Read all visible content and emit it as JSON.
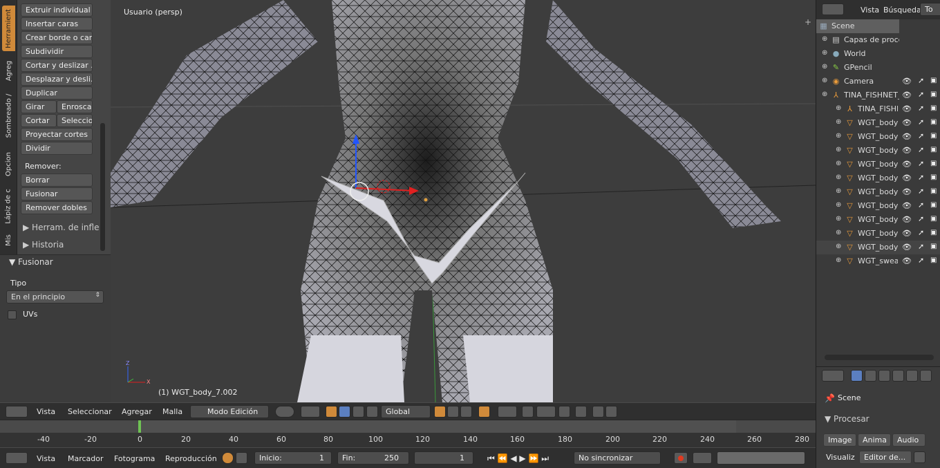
{
  "tool_tabs": [
    "Herramient",
    "Agreg",
    "Sombreado /",
    "Opcion",
    "Lápiz de c",
    "Mis"
  ],
  "tool_shelf": {
    "buttons": [
      "Extruir individual",
      "Insertar caras",
      "Crear borde o cara",
      "Subdividir",
      "Cortar y deslizar ...",
      "Desplazar y desli...",
      "Duplicar"
    ],
    "girar": "Girar",
    "enroscar": "Enroscar",
    "cortar": "Cortar",
    "seleccio": "Seleccio",
    "proyectar": "Proyectar cortes",
    "dividir": "Dividir",
    "remover_label": "Remover:",
    "borrar": "Borrar",
    "fusionar": "Fusionar",
    "remover_dobles": "Remover dobles",
    "panel_herram": "Herram. de infle",
    "panel_historia": "Historia"
  },
  "operator_panel": {
    "title": "Fusionar",
    "tipo_label": "Tipo",
    "tipo_value": "En el principio",
    "uvs_label": "UVs"
  },
  "viewport": {
    "view_label": "Usuario (persp)",
    "object_label": "(1) WGT_body_7.002",
    "axis_z": "Z",
    "axis_x": "X"
  },
  "view3d_header": {
    "vista": "Vista",
    "seleccionar": "Seleccionar",
    "agregar": "Agregar",
    "malla": "Malla",
    "mode": "Modo Edición",
    "orientation": "Global"
  },
  "timeline": {
    "ticks": [
      "-40",
      "-20",
      "0",
      "20",
      "40",
      "60",
      "80",
      "100",
      "120",
      "140",
      "160",
      "180",
      "200",
      "220",
      "240",
      "260",
      "280"
    ],
    "current_frame": 0
  },
  "timeline_header": {
    "vista": "Vista",
    "marcador": "Marcador",
    "fotograma": "Fotograma",
    "reproduccion": "Reproducción",
    "inicio_label": "Inicio:",
    "inicio_value": "1",
    "fin_label": "Fin:",
    "fin_value": "250",
    "frame_value": "1",
    "sync": "No sincronizar"
  },
  "outliner_header": {
    "vista": "Vista",
    "busqueda": "Búsqueda",
    "todas": "To"
  },
  "outliner": [
    {
      "name": "Scene",
      "icon": "scene-icon",
      "level": 0
    },
    {
      "name": "Capas de proce",
      "icon": "render-layers-icon",
      "level": 1
    },
    {
      "name": "World",
      "icon": "world-icon",
      "level": 1
    },
    {
      "name": "GPencil",
      "icon": "gpencil-icon",
      "level": 1
    },
    {
      "name": "Camera",
      "icon": "camera-icon",
      "level": 1
    },
    {
      "name": "TINA_FISHNET_",
      "icon": "armature-icon",
      "level": 1
    },
    {
      "name": "TINA_FISHN",
      "icon": "armature-data-icon",
      "level": 2
    },
    {
      "name": "WGT_body_",
      "icon": "mesh-icon",
      "level": 2
    },
    {
      "name": "WGT_body_",
      "icon": "mesh-icon",
      "level": 2
    },
    {
      "name": "WGT_body_",
      "icon": "mesh-icon",
      "level": 2
    },
    {
      "name": "WGT_body_",
      "icon": "mesh-icon",
      "level": 2
    },
    {
      "name": "WGT_body_",
      "icon": "mesh-icon",
      "level": 2
    },
    {
      "name": "WGT_body_",
      "icon": "mesh-icon",
      "level": 2
    },
    {
      "name": "WGT_body_",
      "icon": "mesh-icon",
      "level": 2
    },
    {
      "name": "WGT_body_",
      "icon": "mesh-icon",
      "level": 2
    },
    {
      "name": "WGT_body_",
      "icon": "mesh-icon",
      "level": 2
    },
    {
      "name": "WGT_body_",
      "icon": "mesh-icon",
      "level": 2
    },
    {
      "name": "WGT_sweat",
      "icon": "mesh-icon",
      "level": 2
    }
  ],
  "properties": {
    "scene_label": "Scene",
    "procesar_label": "Procesar",
    "image_btn": "Image",
    "anima_btn": "Anima",
    "audio_btn": "Audio",
    "visualiz_label": "Visualiz",
    "editor_value": "Editor de..."
  },
  "colors": {
    "accent": "#d08a3a",
    "timeline_cursor": "#6fc254",
    "outliner_selected": "#6b6b6b"
  }
}
